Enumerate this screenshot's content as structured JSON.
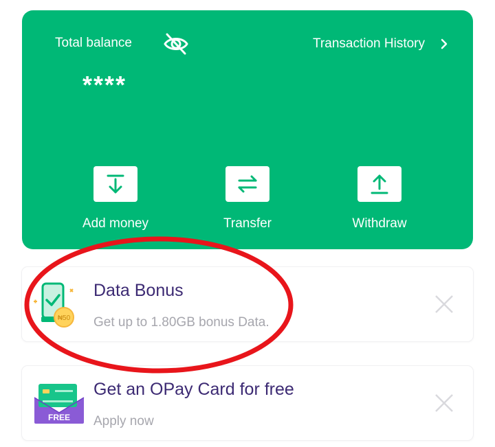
{
  "balance": {
    "label": "Total balance",
    "amount": "****",
    "history_label": "Transaction History"
  },
  "actions": [
    {
      "label": "Add money",
      "icon": "arrow-down-into-tray-icon"
    },
    {
      "label": "Transfer",
      "icon": "swap-arrows-icon"
    },
    {
      "label": "Withdraw",
      "icon": "arrow-up-from-tray-icon"
    }
  ],
  "promos": [
    {
      "title": "Data Bonus",
      "subtitle": "Get up to 1.80GB bonus Data.",
      "badge": "₦50"
    },
    {
      "title": "Get an OPay Card for free",
      "subtitle": "Apply now",
      "badge": "FREE"
    }
  ],
  "colors": {
    "brand_green": "#00b876",
    "title_purple": "#3c2a73",
    "annotation_red": "#e8151b"
  }
}
